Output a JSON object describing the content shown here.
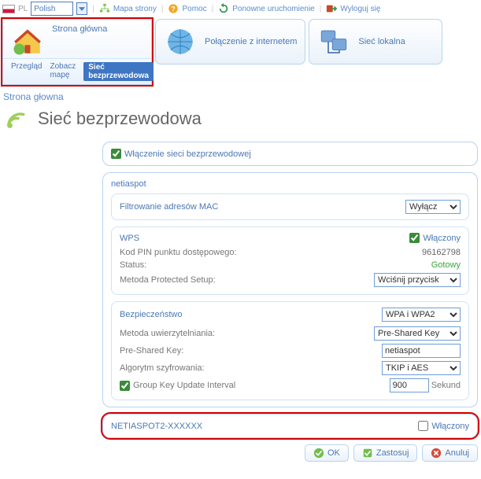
{
  "topbar": {
    "lang_label": "Polish",
    "sitemap": "Mapa strony",
    "help": "Pomoc",
    "restart": "Ponowne uruchomienie",
    "logout": "Wyloguj się"
  },
  "nav": {
    "home": "Strona główna",
    "internet": "Połączenie z internetem",
    "lan": "Sieć lokalna",
    "subtabs": {
      "overview": "Przegląd",
      "map": "Zobacz mapę",
      "wireless": "Sieć bezprzewodowa"
    }
  },
  "crumb": "Strona głowna",
  "page_title": "Sieć bezprzewodowa",
  "enable_wifi_label": "Włączenie sieci bezprzewodowej",
  "ssid1": {
    "name": "netiaspot",
    "mac_filter_label": "Filtrowanie adresów MAC",
    "mac_filter_value": "Wyłącz",
    "wps_label": "WPS",
    "wps_enabled_label": "Włączony",
    "wps_pin_label": "Kod PIN punktu dostępowego:",
    "wps_pin_value": "96162798",
    "wps_status_label": "Status:",
    "wps_status_value": "Gotowy",
    "wps_method_label": "Metoda Protected Setup:",
    "wps_method_value": "Wciśnij przycisk",
    "sec_label": "Bezpieczeństwo",
    "sec_mode": "WPA i WPA2",
    "auth_label": "Metoda uwierzytelniania:",
    "auth_value": "Pre-Shared Key",
    "psk_label": "Pre-Shared Key:",
    "psk_value": "netiaspot",
    "enc_label": "Algorytm szyfrowania:",
    "enc_value": "TKIP i AES",
    "gku_label": "Group Key Update Interval",
    "gku_value": "900",
    "gku_unit": "Sekund"
  },
  "ssid2": {
    "name": "NETIASPOT2-XXXXXX",
    "enabled_label": "Włączony"
  },
  "buttons": {
    "ok": "OK",
    "apply": "Zastosuj",
    "cancel": "Anuluj"
  }
}
